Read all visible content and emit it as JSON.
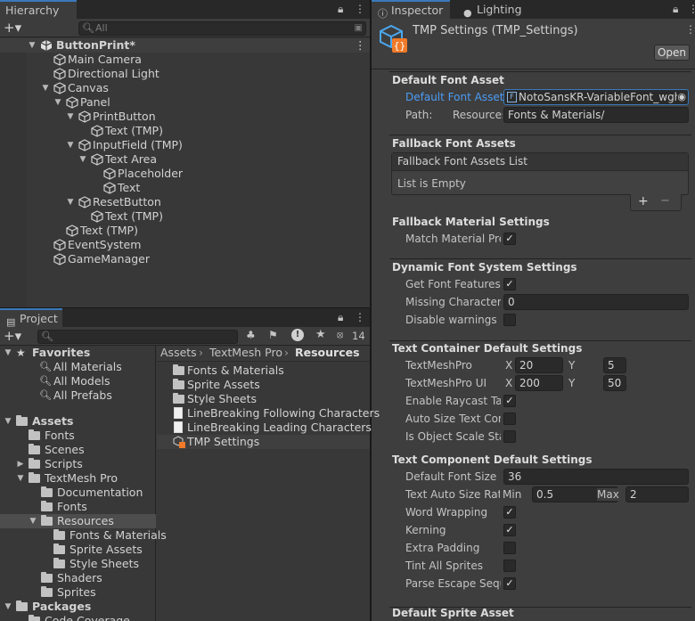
{
  "hierarchy": {
    "tab_label": "Hierarchy",
    "search_placeholder": "All",
    "items": [
      {
        "label": "ButtonPrint*"
      },
      {
        "label": "Main Camera"
      },
      {
        "label": "Directional Light"
      },
      {
        "label": "Canvas"
      },
      {
        "label": "Panel"
      },
      {
        "label": "PrintButton"
      },
      {
        "label": "Text (TMP)"
      },
      {
        "label": "InputField (TMP)"
      },
      {
        "label": "Text Area"
      },
      {
        "label": "Placeholder"
      },
      {
        "label": "Text"
      },
      {
        "label": "ResetButton"
      },
      {
        "label": "Text (TMP)"
      },
      {
        "label": "Text (TMP)"
      },
      {
        "label": "EventSystem"
      },
      {
        "label": "GameManager"
      }
    ]
  },
  "project": {
    "tab_label": "Project",
    "hidden_count": "14",
    "tree": [
      {
        "label": "Favorites"
      },
      {
        "label": "All Materials"
      },
      {
        "label": "All Models"
      },
      {
        "label": "All Prefabs"
      },
      {
        "label": "Assets"
      },
      {
        "label": "Fonts"
      },
      {
        "label": "Scenes"
      },
      {
        "label": "Scripts"
      },
      {
        "label": "TextMesh Pro"
      },
      {
        "label": "Documentation"
      },
      {
        "label": "Fonts"
      },
      {
        "label": "Resources"
      },
      {
        "label": "Fonts & Materials"
      },
      {
        "label": "Sprite Assets"
      },
      {
        "label": "Style Sheets"
      },
      {
        "label": "Shaders"
      },
      {
        "label": "Sprites"
      },
      {
        "label": "Packages"
      },
      {
        "label": "Code Coverage"
      }
    ],
    "breadcrumb": [
      "Assets",
      "TextMesh Pro",
      "Resources"
    ],
    "files": [
      {
        "label": "Fonts & Materials"
      },
      {
        "label": "Sprite Assets"
      },
      {
        "label": "Style Sheets"
      },
      {
        "label": "LineBreaking Following Characters"
      },
      {
        "label": "LineBreaking Leading Characters"
      },
      {
        "label": "TMP Settings"
      }
    ]
  },
  "inspector": {
    "tab_label": "Inspector",
    "lighting_tab_label": "Lighting",
    "title": "TMP Settings (TMP_Settings)",
    "open_button": "Open",
    "default_font": {
      "section": "Default Font Asset",
      "asset_label": "Default Font Asset",
      "asset_value": "NotoSansKR-VariableFont_wght",
      "path_label": "Path:",
      "path_prefix": "Resources/",
      "path_value": "Fonts & Materials/"
    },
    "fallback": {
      "section": "Fallback Font Assets",
      "list_header": "Fallback Font Assets List",
      "list_empty": "List is Empty",
      "add": "+",
      "remove": "−",
      "material_section": "Fallback Material Settings",
      "match_material": "Match Material Preset"
    },
    "dynamic": {
      "section": "Dynamic Font System Settings",
      "get_font_features": "Get Font Features at Runtime",
      "missing_char": "Missing Character Unicode",
      "missing_char_value": "0",
      "disable_warnings": "Disable warnings"
    },
    "container": {
      "section": "Text Container Default Settings",
      "tmp_label": "TextMeshPro",
      "tmp_x": "20",
      "tmp_y": "5",
      "tmpui_label": "TextMeshPro UI",
      "tmpui_x": "200",
      "tmpui_y": "50",
      "x_label": "X",
      "y_label": "Y",
      "raycast": "Enable Raycast Target",
      "auto_size": "Auto Size Text Container",
      "object_scale": "Is Object Scale Static"
    },
    "component": {
      "section": "Text Component Default Settings",
      "font_size_label": "Default Font Size",
      "font_size_value": "36",
      "auto_ratio_label": "Text Auto Size Ratios",
      "min_label": "Min",
      "min_value": "0.5",
      "max_label": "Max",
      "max_value": "2",
      "word_wrapping": "Word Wrapping",
      "kerning": "Kerning",
      "extra_padding": "Extra Padding",
      "tint_sprites": "Tint All Sprites",
      "parse_escape": "Parse Escape Sequence"
    },
    "sprite_section": "Default Sprite Asset"
  },
  "icons": {
    "lock": "lock-icon",
    "menu": "kebab-menu-icon",
    "gameobject": "gameobject-cube-icon",
    "folder": "folder-icon",
    "search": "search-icon",
    "script_asset": "tmp-settings-asset-icon"
  },
  "colors": {
    "accent": "#3a79bb",
    "link_blue": "#4c9cf5",
    "selection": "#2c5d87"
  }
}
